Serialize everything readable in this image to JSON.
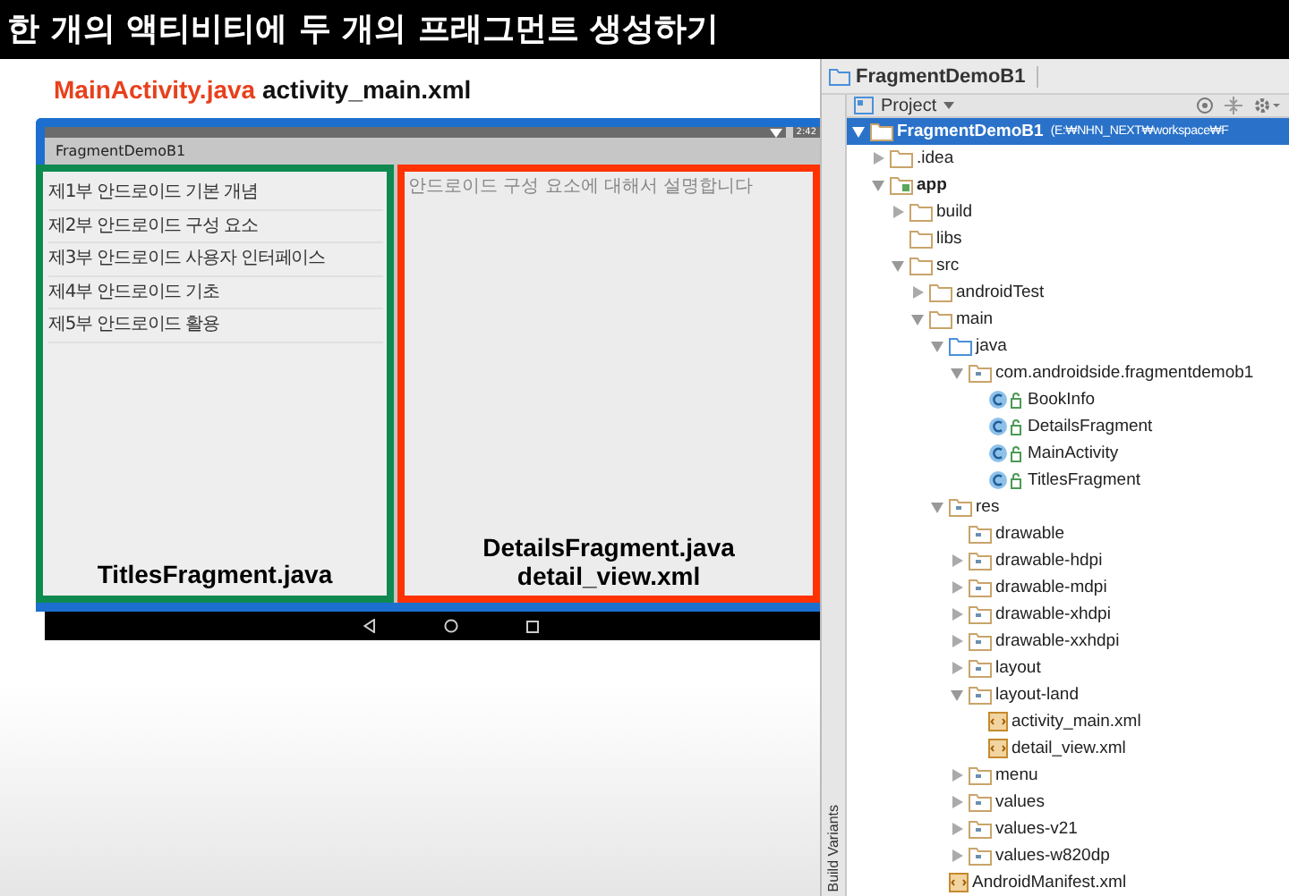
{
  "title": "한 개의 액티비티에 두 개의 프래그먼트 생성하기",
  "heading": {
    "class_file": "MainActivity.java",
    "layout_file": "activity_main.xml"
  },
  "emulator": {
    "status_time": "2:42",
    "app_title": "FragmentDemoB1",
    "titles": [
      "제1부 안드로이드 기본 개념",
      "제2부 안드로이드 구성 요소",
      "제3부 안드로이드 사용자 인터페이스",
      "제4부 안드로이드 기초",
      "제5부 안드로이드 활용"
    ],
    "detail_text": "안드로이드 구성 요소에 대해서 설명합니다",
    "titles_label": "TitlesFragment.java",
    "details_label": [
      "DetailsFragment.java",
      "detail_view.xml"
    ]
  },
  "ide": {
    "breadcrumb": "FragmentDemoB1",
    "view_selector": "Project",
    "side_tab": "Build Variants",
    "tree": [
      {
        "label": "FragmentDemoB1",
        "path": "(E:₩NHN_NEXT₩workspace₩F",
        "kind": "folder",
        "expanded": true,
        "selected": true,
        "children": [
          {
            "label": ".idea",
            "kind": "folder",
            "expanded": false,
            "selected": false
          },
          {
            "label": "app",
            "kind": "module",
            "expanded": true,
            "selected": false,
            "children": [
              {
                "label": "build",
                "kind": "folder",
                "expanded": false,
                "selected": false
              },
              {
                "label": "libs",
                "kind": "folder",
                "selected": false
              },
              {
                "label": "src",
                "kind": "folder",
                "expanded": true,
                "selected": false,
                "children": [
                  {
                    "label": "androidTest",
                    "kind": "folder",
                    "expanded": false,
                    "selected": false
                  },
                  {
                    "label": "main",
                    "kind": "folder",
                    "expanded": true,
                    "selected": false,
                    "children": [
                      {
                        "label": "java",
                        "kind": "source_folder",
                        "expanded": true,
                        "selected": false,
                        "children": [
                          {
                            "label": "com.androidside.fragmentdemob1",
                            "kind": "package",
                            "expanded": true,
                            "selected": false,
                            "children": [
                              {
                                "label": "BookInfo",
                                "kind": "class",
                                "selected": false
                              },
                              {
                                "label": "DetailsFragment",
                                "kind": "class",
                                "selected": false
                              },
                              {
                                "label": "MainActivity",
                                "kind": "class",
                                "selected": false
                              },
                              {
                                "label": "TitlesFragment",
                                "kind": "class",
                                "selected": false
                              }
                            ]
                          }
                        ]
                      },
                      {
                        "label": "res",
                        "kind": "res_folder",
                        "expanded": true,
                        "selected": false,
                        "children": [
                          {
                            "label": "drawable",
                            "kind": "package",
                            "selected": false
                          },
                          {
                            "label": "drawable-hdpi",
                            "kind": "package",
                            "expanded": false,
                            "selected": false
                          },
                          {
                            "label": "drawable-mdpi",
                            "kind": "package",
                            "expanded": false,
                            "selected": false
                          },
                          {
                            "label": "drawable-xhdpi",
                            "kind": "package",
                            "expanded": false,
                            "selected": false
                          },
                          {
                            "label": "drawable-xxhdpi",
                            "kind": "package",
                            "expanded": false,
                            "selected": false
                          },
                          {
                            "label": "layout",
                            "kind": "package",
                            "expanded": false,
                            "selected": false
                          },
                          {
                            "label": "layout-land",
                            "kind": "package",
                            "expanded": true,
                            "selected": false,
                            "children": [
                              {
                                "label": "activity_main.xml",
                                "kind": "xml",
                                "selected": false
                              },
                              {
                                "label": "detail_view.xml",
                                "kind": "xml",
                                "selected": false
                              }
                            ]
                          },
                          {
                            "label": "menu",
                            "kind": "package",
                            "expanded": false,
                            "selected": false
                          },
                          {
                            "label": "values",
                            "kind": "package",
                            "expanded": false,
                            "selected": false
                          },
                          {
                            "label": "values-v21",
                            "kind": "package",
                            "expanded": false,
                            "selected": false
                          },
                          {
                            "label": "values-w820dp",
                            "kind": "package",
                            "expanded": false,
                            "selected": false
                          }
                        ]
                      },
                      {
                        "label": "AndroidManifest.xml",
                        "kind": "xml",
                        "selected": false
                      }
                    ]
                  }
                ]
              }
            ]
          }
        ]
      }
    ]
  }
}
